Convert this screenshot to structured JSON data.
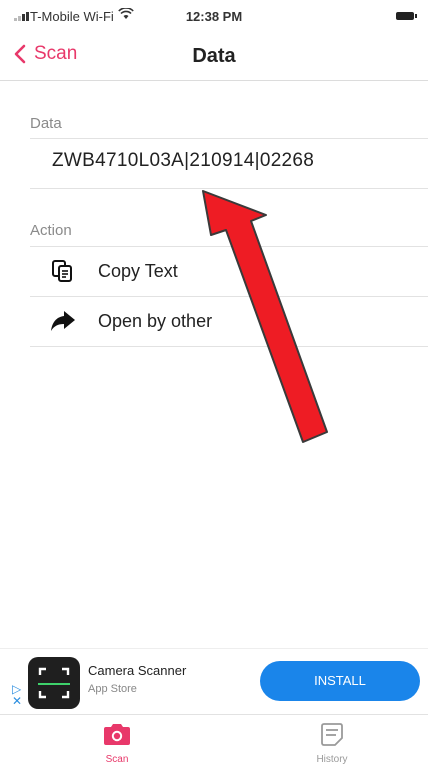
{
  "status_bar": {
    "carrier": "T-Mobile Wi-Fi",
    "time": "12:38 PM"
  },
  "nav": {
    "back_label": "Scan",
    "title": "Data"
  },
  "data_section": {
    "header": "Data",
    "value": "ZWB4710L03A|210914|02268"
  },
  "action_section": {
    "header": "Action",
    "items": [
      {
        "label": "Copy Text",
        "icon": "copy-text-icon"
      },
      {
        "label": "Open by other",
        "icon": "share-arrow-icon"
      }
    ]
  },
  "ad": {
    "app_name": "Camera Scanner",
    "store": "App Store",
    "install_label": "INSTALL"
  },
  "tabs": [
    {
      "label": "Scan",
      "icon": "camera-icon",
      "active": true
    },
    {
      "label": "History",
      "icon": "history-icon",
      "active": false
    }
  ],
  "colors": {
    "accent": "#e8386a",
    "install": "#1a85ea",
    "annotation_arrow": "#ee1c24"
  }
}
